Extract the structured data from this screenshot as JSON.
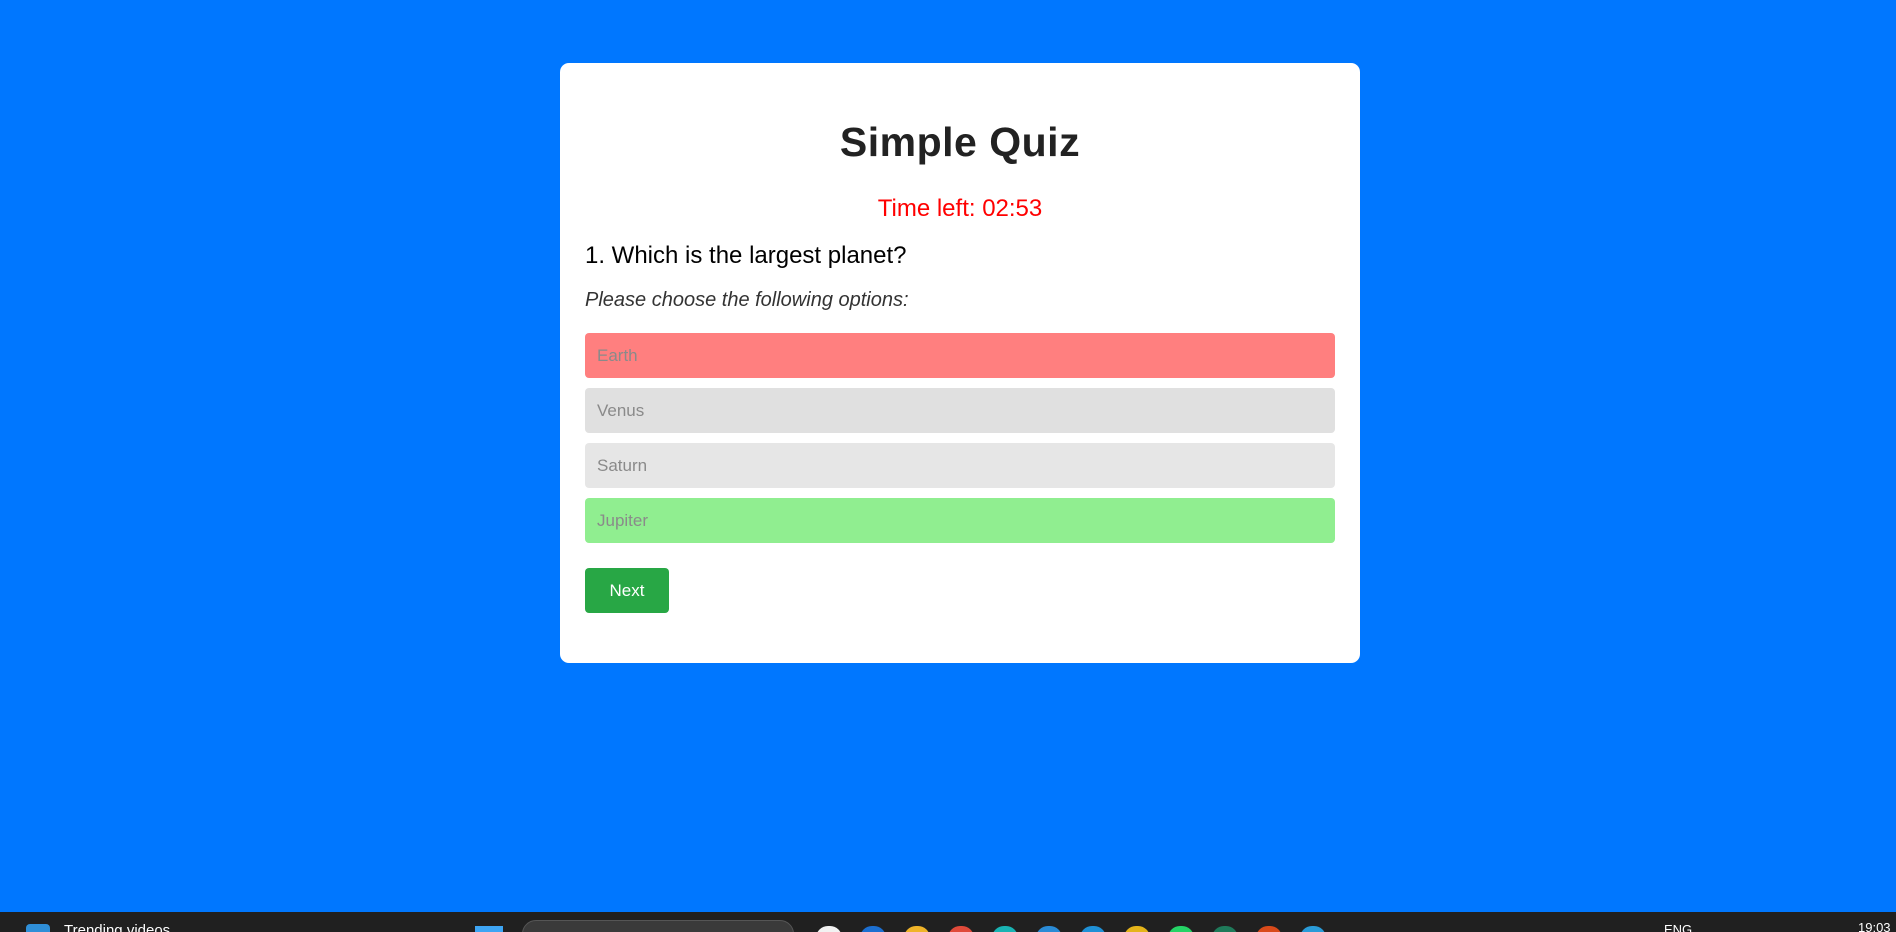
{
  "quiz": {
    "title": "Simple Quiz",
    "timer_text": "Time left: 02:53",
    "question_text": "1. Which is the largest planet?",
    "instruction_text": "Please choose the following options:",
    "options": [
      {
        "label": "Earth",
        "state": "incorrect-selected",
        "color": "#ff7f7f"
      },
      {
        "label": "Venus",
        "state": "neutral",
        "color": "#e0e0e0"
      },
      {
        "label": "Saturn",
        "state": "neutral",
        "color": "#e6e6e6"
      },
      {
        "label": "Jupiter",
        "state": "correct",
        "color": "#90ee90"
      }
    ],
    "next_label": "Next"
  },
  "colors": {
    "background": "#0077ff",
    "timer": "#ff0000",
    "next_button": "#28a745"
  },
  "taskbar": {
    "weather_text": "Trending videos",
    "language": "ENG",
    "time": "19:03",
    "app_icons": [
      {
        "name": "store-app-icon",
        "color": "#f2f2f2"
      },
      {
        "name": "edge-app-icon",
        "color": "#1c6fd1"
      },
      {
        "name": "file-explorer-icon",
        "color": "#f0b429"
      },
      {
        "name": "red-app-icon",
        "color": "#e04a3a"
      },
      {
        "name": "teal-app-icon",
        "color": "#19b3b3"
      },
      {
        "name": "blue-app-icon",
        "color": "#2a8bd6"
      },
      {
        "name": "window-app-icon",
        "color": "#1f90d6"
      },
      {
        "name": "chrome-app-icon",
        "color": "#e5b41a"
      },
      {
        "name": "whatsapp-app-icon",
        "color": "#25d366"
      },
      {
        "name": "green-app-icon",
        "color": "#1f7a5a"
      },
      {
        "name": "recording-app-icon",
        "color": "#d94a1a"
      },
      {
        "name": "vscode-app-icon",
        "color": "#2a9bd8"
      }
    ]
  }
}
